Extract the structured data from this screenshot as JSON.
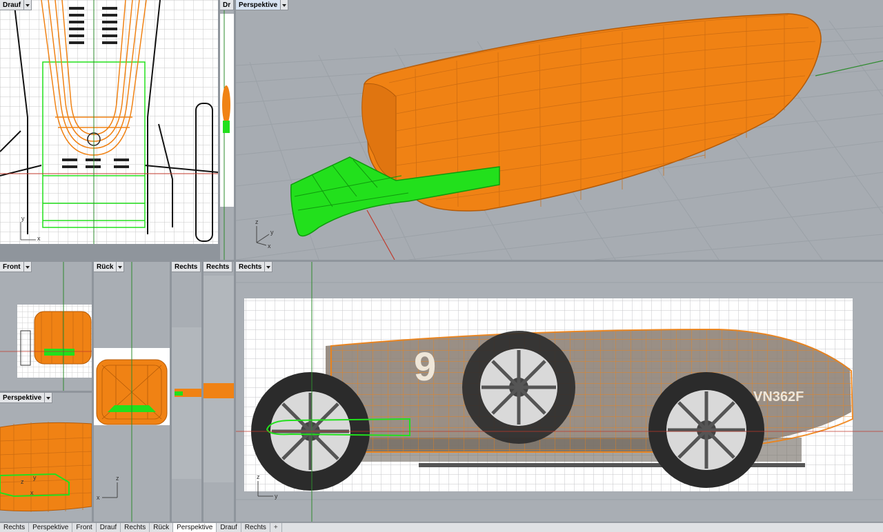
{
  "viewports": {
    "top_left": {
      "title": "Drauf"
    },
    "top_small": {
      "title": "Dr"
    },
    "perspective_main": {
      "title": "Perspektive"
    },
    "front": {
      "title": "Front"
    },
    "rueck": {
      "title": "Rück"
    },
    "rechts_a": {
      "title": "Rechts"
    },
    "rechts_b": {
      "title": "Rechts"
    },
    "rechts_main": {
      "title": "Rechts"
    },
    "perspective_small": {
      "title": "Perspektive"
    }
  },
  "axis_labels": {
    "x": "x",
    "y": "y",
    "z": "z"
  },
  "car_decal": {
    "number": "9",
    "plate": "VN362F"
  },
  "tabs": [
    {
      "label": "Rechts"
    },
    {
      "label": "Perspektive"
    },
    {
      "label": "Front"
    },
    {
      "label": "Drauf"
    },
    {
      "label": "Rechts"
    },
    {
      "label": "Rück"
    },
    {
      "label": "Perspektive",
      "active": true
    },
    {
      "label": "Drauf"
    },
    {
      "label": "Rechts"
    },
    {
      "label": "+"
    }
  ],
  "colors": {
    "model_orange": "#f08214",
    "model_orange_dark": "#c9640a",
    "surface_green": "#22e01c",
    "grid_line": "#9aa0a6",
    "viewport_bg": "#a9aeb4",
    "active_title": "#d7e3f2"
  }
}
